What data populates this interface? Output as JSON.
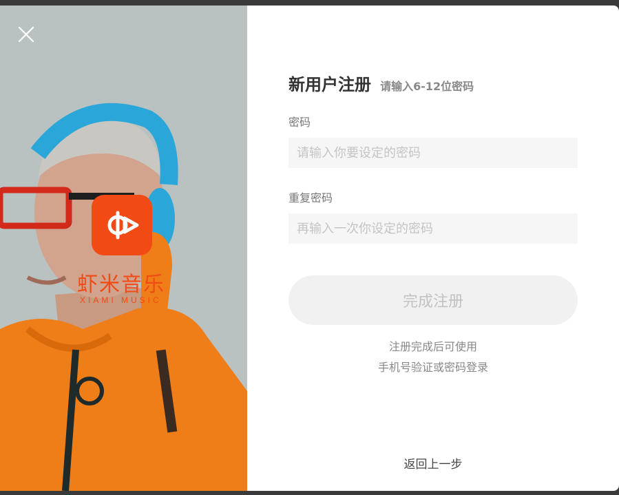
{
  "dialog": {
    "title": "新用户注册",
    "subtitle": "请输入6-12位密码",
    "password_label": "密码",
    "password_placeholder": "请输入你要设定的密码",
    "password_value": "",
    "repeat_label": "重复密码",
    "repeat_placeholder": "再输入一次你设定的密码",
    "repeat_value": "",
    "submit_label": "完成注册",
    "hint_line1": "注册完成后可使用",
    "hint_line2": "手机号验证或密码登录",
    "back_label": "返回上一步"
  },
  "hero": {
    "logo_cn": "虾米音乐",
    "logo_en": "XIAMI MUSIC",
    "logo_icon": "xiami-logo-icon",
    "close_icon": "close-icon"
  },
  "colors": {
    "brand": "#f24a14",
    "hoodie": "#ef7d18",
    "headphones": "#2aa7d8",
    "submit_bg": "#f1f1f1",
    "input_bg": "#f6f6f6"
  }
}
